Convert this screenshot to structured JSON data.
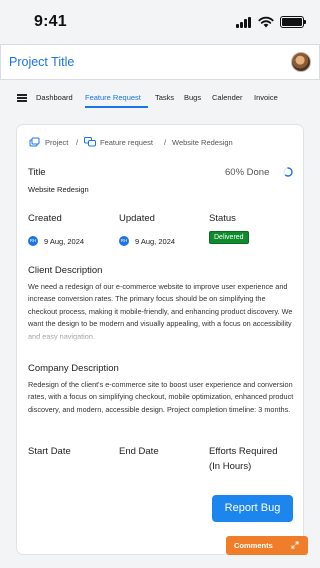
{
  "status_bar": {
    "time": "9:41"
  },
  "header": {
    "title": "Project Title"
  },
  "nav": {
    "items": [
      {
        "label": "Dashboard"
      },
      {
        "label": "Feature Request"
      },
      {
        "label": "Tasks"
      },
      {
        "label": "Bugs"
      },
      {
        "label": "Calender"
      },
      {
        "label": "Invoice"
      }
    ],
    "active_index": 1
  },
  "breadcrumb": {
    "items": [
      "Project",
      "Feature request",
      "Website Redesign"
    ],
    "separator": "/"
  },
  "task": {
    "title_label": "Title",
    "title_value": "Website Redesign",
    "progress_text": "60% Done",
    "progress_fraction": 0.6,
    "created_label": "Created",
    "created_initials": "RH",
    "created_date": "9 Aug, 2024",
    "updated_label": "Updated",
    "updated_initials": "RH",
    "updated_date": "9 Aug, 2024",
    "status_label": "Status",
    "status_value": "Delivered",
    "client_description_label": "Client Description",
    "client_description": "We need a redesign of our e-commerce website to improve user experience and increase conversion rates. The primary focus should be on simplifying the checkout process, making it mobile-friendly, and enhancing product discovery. We want the design to be modern and visually appealing, with a focus on accessibility and easy navigation.",
    "company_description_label": "Company Description",
    "company_description": "Redesign of the client's e-commerce site to boost user experience and conversion rates, with a focus on simplifying checkout, mobile optimization, enhanced product discovery, and modern, accessible design. Project completion timeline: 3 months.",
    "start_date_label": "Start Date",
    "end_date_label": "End Date",
    "efforts_label_line1": "Efforts Required",
    "efforts_label_line2": "(In Hours)"
  },
  "actions": {
    "report_bug_label": "Report Bug",
    "comments_label": "Comments"
  },
  "colors": {
    "accent": "#1c74e9",
    "button_blue": "#1c86ee",
    "status_green": "#0f8a2c",
    "comments_orange": "#f07d2a"
  }
}
